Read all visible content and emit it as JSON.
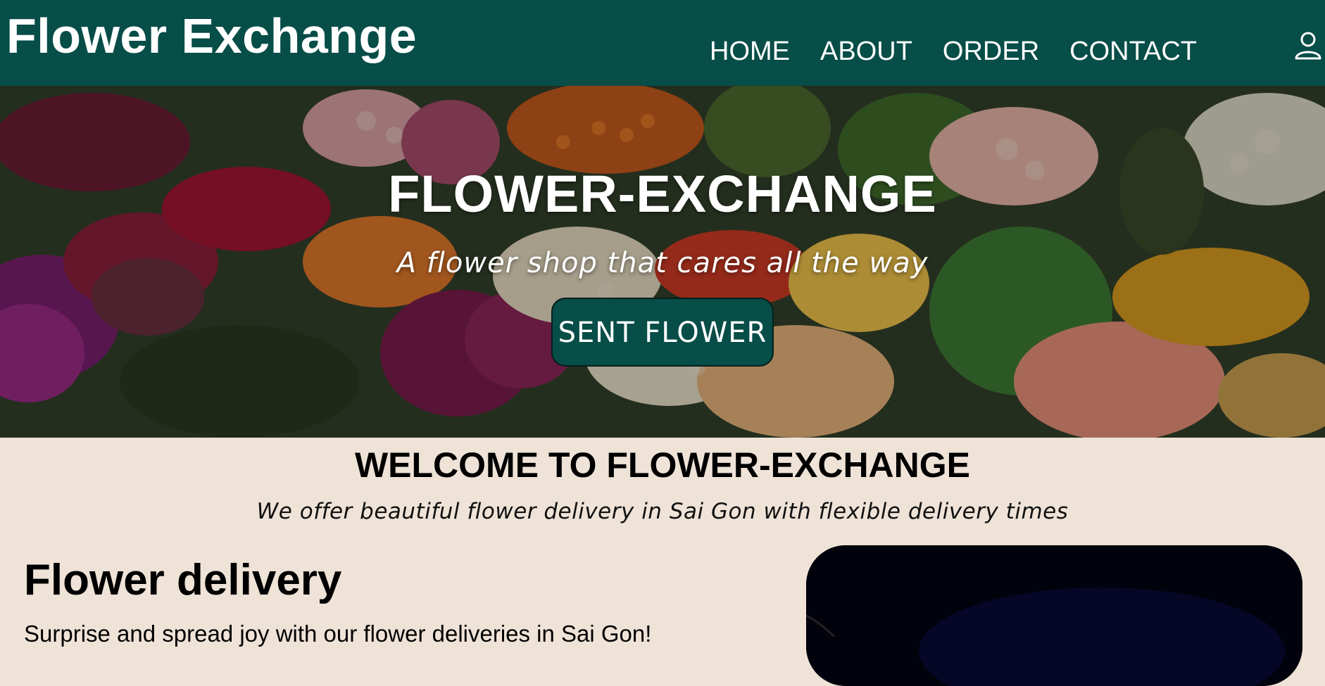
{
  "header": {
    "brand": "Flower Exchange",
    "nav": [
      {
        "label": "HOME"
      },
      {
        "label": "ABOUT"
      },
      {
        "label": "ORDER"
      },
      {
        "label": "CONTACT"
      }
    ],
    "user_icon": "user-icon",
    "background": "#074d48"
  },
  "hero": {
    "title": "FLOWER-EXCHANGE",
    "subtitle": "A flower shop that cares all the way",
    "button_label": "SENT FLOWER",
    "background_image": "flower-market-photo"
  },
  "welcome": {
    "title": "WELCOME TO FLOWER-EXCHANGE",
    "subtitle": "We offer beautiful flower delivery in Sai Gon with flexible delivery times"
  },
  "delivery": {
    "title": "Flower delivery",
    "text": "Surprise and spread joy with our flower deliveries in Sai Gon!"
  },
  "colors": {
    "brand_green": "#074d48",
    "page_background": "#efe3d8"
  }
}
